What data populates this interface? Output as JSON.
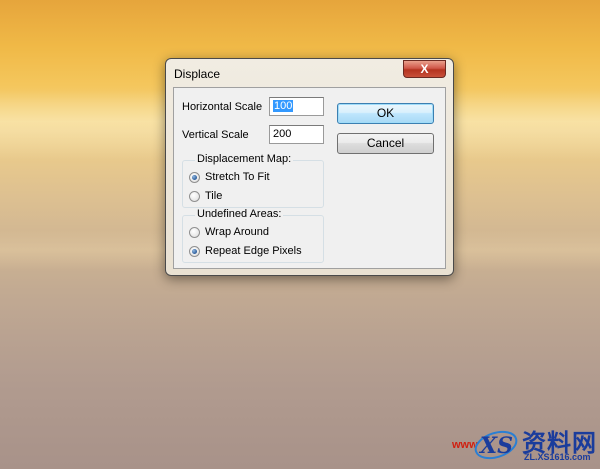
{
  "dialog": {
    "title": "Displace",
    "close_symbol": "X",
    "horizontal_scale": {
      "label": "Horizontal Scale",
      "value": "100"
    },
    "vertical_scale": {
      "label": "Vertical Scale",
      "value": "200"
    },
    "ok_label": "OK",
    "cancel_label": "Cancel",
    "displacement_map": {
      "title": "Displacement Map:",
      "options": [
        {
          "label": "Stretch To Fit",
          "selected": true
        },
        {
          "label": "Tile",
          "selected": false
        }
      ]
    },
    "undefined_areas": {
      "title": "Undefined Areas:",
      "options": [
        {
          "label": "Wrap Around",
          "selected": false
        },
        {
          "label": "Repeat Edge Pixels",
          "selected": true
        }
      ]
    }
  },
  "watermark": {
    "prefix": "www",
    "site_name": "资料网",
    "url": "ZL.XS1616.com",
    "logo_letters": "XS"
  }
}
